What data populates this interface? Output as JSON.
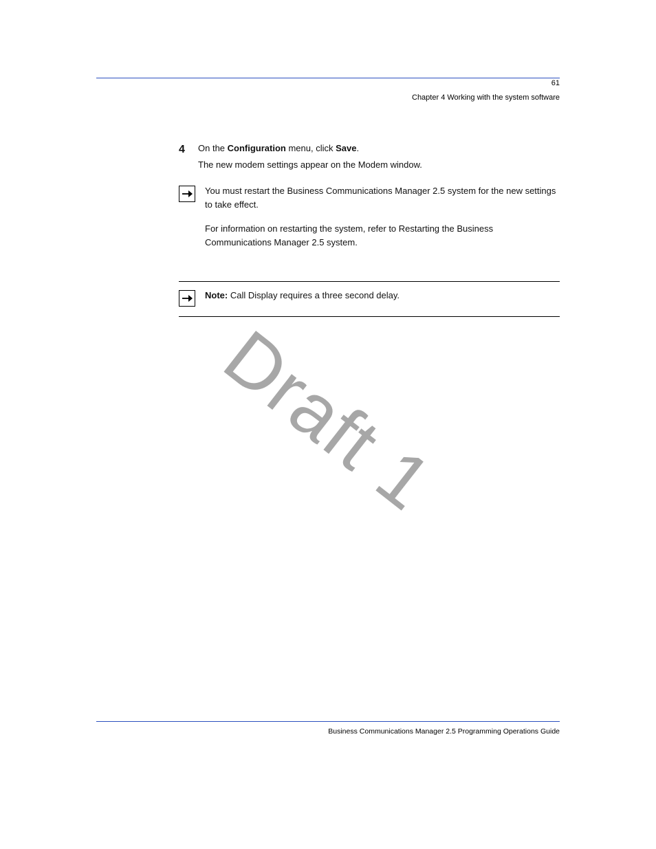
{
  "header": {
    "page_number": "61",
    "chapter_line": "Chapter 4 Working with the system software"
  },
  "body": {
    "para1": "You must restart the Business Communications Manager 2.5 system for the new settings to take effect.",
    "para2_prefix": "For information on restarting the system, refer to ",
    "para2_link": "Restarting the Business Communications Manager 2.5 system",
    "para2_suffix": ".",
    "step": {
      "number": "4",
      "heading_prefix": "On the ",
      "heading_bold": "Configuration",
      "heading_suffix": " menu, click ",
      "heading_bold2": "Save",
      "heading_end": ".",
      "sub_text": "The new modem settings appear on the Modem window."
    },
    "note": {
      "label": "Note:",
      "text": "Call Display requires a three second delay."
    }
  },
  "watermark": "Draft 1",
  "footer": {
    "text": "Business Communications Manager 2.5 Programming Operations Guide"
  }
}
